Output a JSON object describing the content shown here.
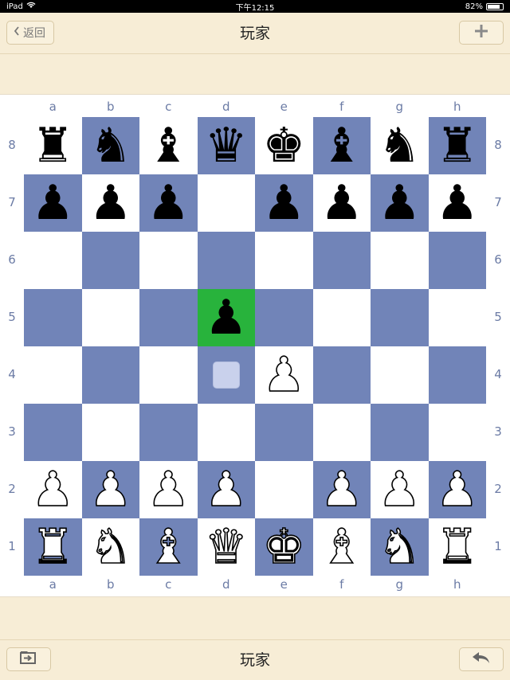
{
  "status": {
    "device": "iPad",
    "time": "下午12:15",
    "battery": "82%",
    "battery_level": 0.82
  },
  "nav": {
    "back_label": "返回",
    "title": "玩家"
  },
  "toolbar": {
    "title": "玩家"
  },
  "board": {
    "files": [
      "a",
      "b",
      "c",
      "d",
      "e",
      "f",
      "g",
      "h"
    ],
    "ranks": [
      "8",
      "7",
      "6",
      "5",
      "4",
      "3",
      "2",
      "1"
    ],
    "last_move": {
      "from": "d4",
      "to": "e4"
    },
    "highlight": "d5",
    "pieces": {
      "a8": "♜",
      "b8": "♞",
      "c8": "♝",
      "d8": "♛",
      "e8": "♚",
      "f8": "♝",
      "g8": "♞",
      "h8": "♜",
      "a7": "♟",
      "b7": "♟",
      "c7": "♟",
      "e7": "♟",
      "f7": "♟",
      "g7": "♟",
      "h7": "♟",
      "d5": "♟",
      "e4": "♙",
      "a2": "♙",
      "b2": "♙",
      "c2": "♙",
      "d2": "♙",
      "f2": "♙",
      "g2": "♙",
      "h2": "♙",
      "a1": "♖",
      "b1": "♘",
      "c1": "♗",
      "d1": "♕",
      "e1": "♔",
      "f1": "♗",
      "g1": "♘",
      "h1": "♖"
    },
    "colors": {
      "light": "#ffffff",
      "dark": "#7184b8",
      "highlight": "#28b33c"
    }
  }
}
